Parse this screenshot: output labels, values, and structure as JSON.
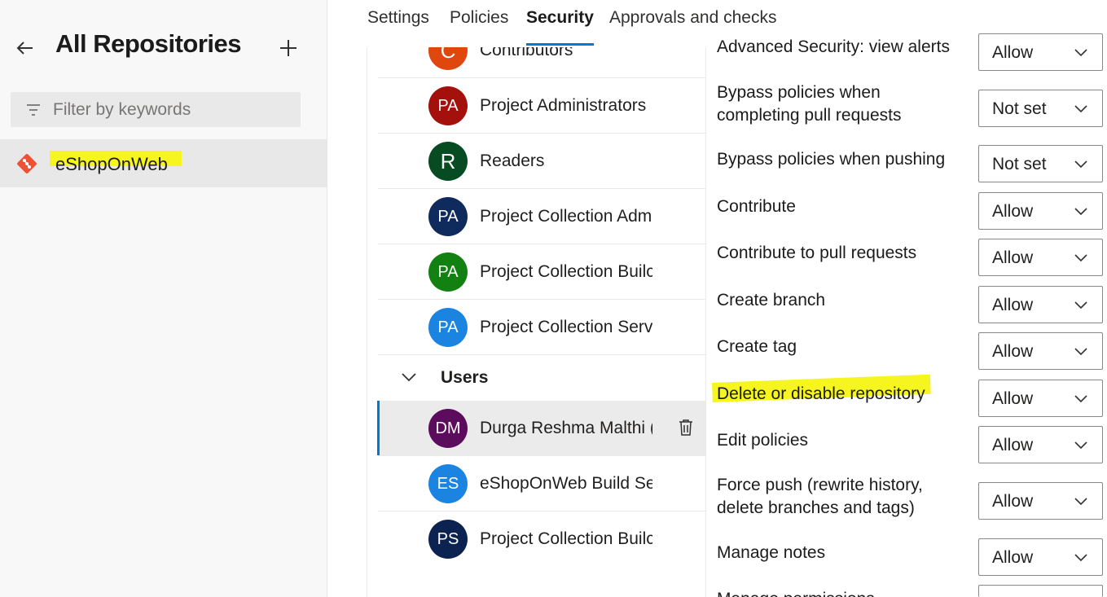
{
  "left": {
    "title": "All Repositories",
    "filter_placeholder": "Filter by keywords",
    "repo_name": "eShopOnWeb"
  },
  "tabs": [
    "Settings",
    "Policies",
    "Security",
    "Approvals and checks"
  ],
  "active_tab": "Security",
  "identities": [
    {
      "initials": "C",
      "name": "Contributors",
      "color": "#e0470f"
    },
    {
      "initials": "PA",
      "name": "Project Administrators",
      "color": "#a4100b"
    },
    {
      "initials": "R",
      "name": "Readers",
      "color": "#064b21"
    },
    {
      "initials": "PA",
      "name": "Project Collection Adm",
      "color": "#0f2a5c"
    },
    {
      "initials": "PA",
      "name": "Project Collection Builc",
      "color": "#128112"
    },
    {
      "initials": "PA",
      "name": "Project Collection Servi",
      "color": "#1a84e0"
    }
  ],
  "users_group_label": "Users",
  "users": [
    {
      "initials": "DM",
      "name": "Durga Reshma Malthi (",
      "color": "#5c0c5d",
      "selected": true
    },
    {
      "initials": "ES",
      "name": "eShopOnWeb Build Ser",
      "color": "#1a84e0",
      "selected": false
    },
    {
      "initials": "PS",
      "name": "Project Collection Builc",
      "color": "#0c2352",
      "selected": false
    }
  ],
  "permissions": [
    {
      "label": "Advanced Security: view alerts",
      "value": "Allow"
    },
    {
      "label": "Bypass policies when completing pull requests",
      "value": "Not set"
    },
    {
      "label": "Bypass policies when pushing",
      "value": "Not set"
    },
    {
      "label": "Contribute",
      "value": "Allow"
    },
    {
      "label": "Contribute to pull requests",
      "value": "Allow"
    },
    {
      "label": "Create branch",
      "value": "Allow"
    },
    {
      "label": "Create tag",
      "value": "Allow"
    },
    {
      "label": "Delete or disable repository",
      "value": "Allow"
    },
    {
      "label": "Edit policies",
      "value": "Allow"
    },
    {
      "label": "Force push (rewrite history, delete branches and tags)",
      "value": "Allow"
    },
    {
      "label": "Manage notes",
      "value": "Allow"
    },
    {
      "label": "Manage permissions",
      "value": ""
    }
  ],
  "colors": {
    "accent": "#0078d4",
    "highlight": "#f6f51f",
    "git_icon": "#f05033"
  }
}
